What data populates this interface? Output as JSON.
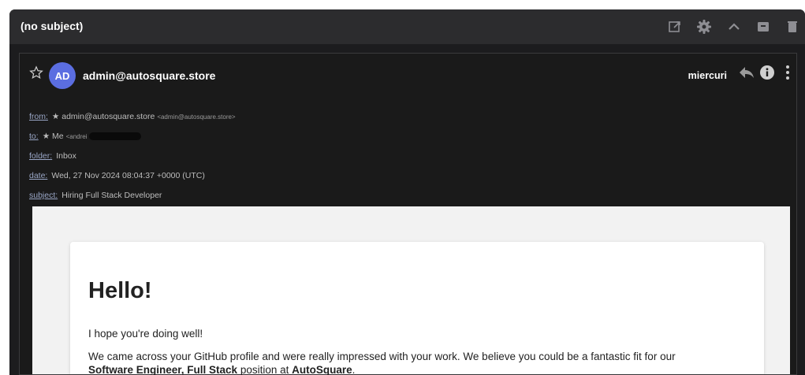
{
  "toolbar": {
    "subject": "(no subject)",
    "icons": [
      "open-new-window-icon",
      "settings-gear-icon",
      "collapse-chevron-up-icon",
      "archive-icon",
      "delete-trash-icon"
    ]
  },
  "message": {
    "avatar_initials": "AD",
    "avatar_color": "#5b6ee1",
    "sender": "admin@autosquare.store",
    "date_short": "miercuri",
    "meta": {
      "from_label": "from:",
      "from_value": "★ admin@autosquare.store",
      "from_email": "<admin@autosquare.store>",
      "to_label": "to:",
      "to_value": "★ Me",
      "to_email_partial": "<andrei",
      "folder_label": "folder:",
      "folder_value": "Inbox",
      "date_label": "date:",
      "date_value": "Wed, 27 Nov 2024 08:04:37 +0000 (UTC)",
      "subject_label": "subject:",
      "subject_value": "Hiring Full Stack Developer"
    }
  },
  "body": {
    "greeting": "Hello!",
    "line1": "I hope you're doing well!",
    "p2_a": "We came across your GitHub profile and were really impressed with your work. We believe you could be a fantastic fit for our ",
    "p2_role": "Software Engineer, Full Stack",
    "p2_b": " position at ",
    "p2_company": "AutoSquare",
    "p2_end": "."
  }
}
